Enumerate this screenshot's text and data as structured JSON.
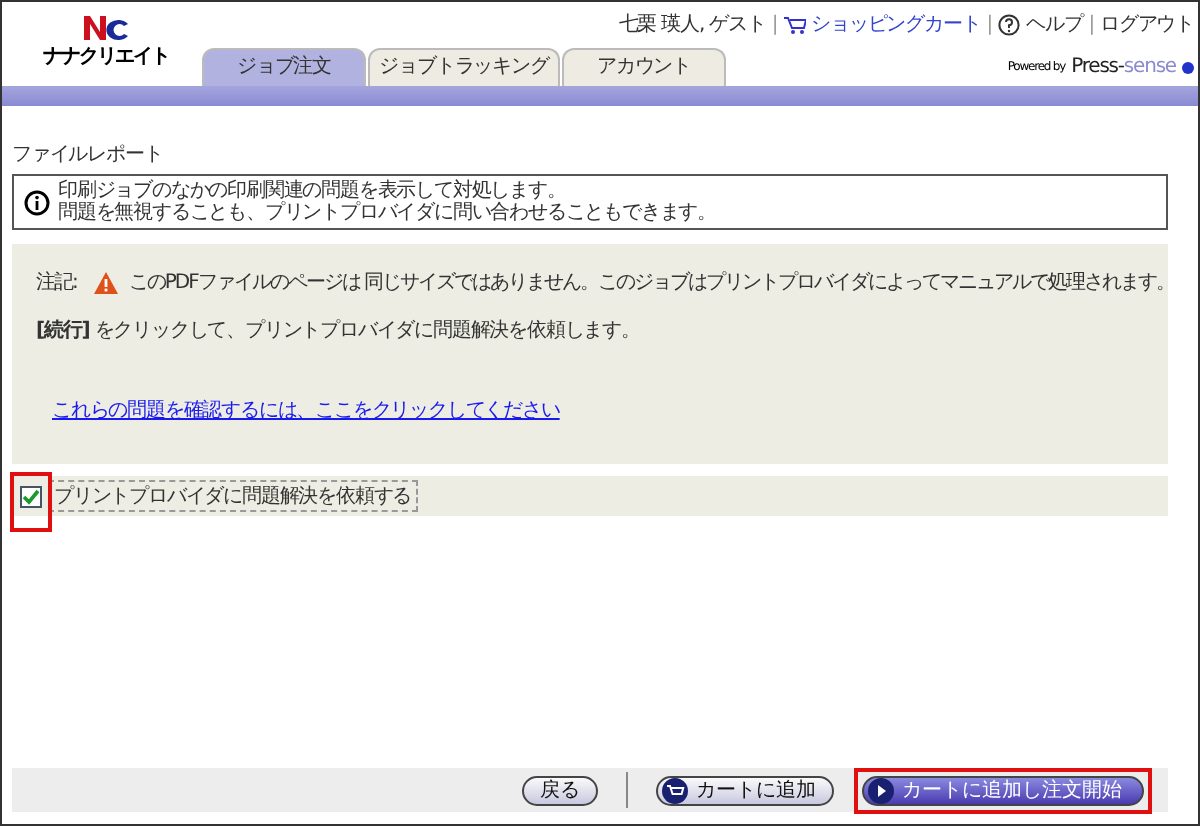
{
  "logo": {
    "text": "ナナクリエイト"
  },
  "tabs": [
    {
      "label": "ジョブ注文",
      "selected": true
    },
    {
      "label": "ジョブトラッキング",
      "selected": false
    },
    {
      "label": "アカウント",
      "selected": false
    }
  ],
  "user_links": [
    {
      "text": "七栗 瑛人, ゲスト",
      "kind": "user"
    },
    {
      "text": "|",
      "kind": "separator"
    },
    {
      "text": "ショッピングカート",
      "kind": "cart"
    },
    {
      "text": "|",
      "kind": "separator"
    },
    {
      "text": "ヘルプ",
      "kind": "help"
    },
    {
      "text": "|",
      "kind": "separator"
    },
    {
      "text": "ログアウト",
      "kind": "logout"
    }
  ],
  "powered_by": {
    "prefix": "Powered by",
    "brand_a": "Press-",
    "brand_b": "sense"
  },
  "page_title": "ファイルレポート",
  "info": {
    "lines": [
      "印刷ジョブのなかの印刷関連の問題を表示して対処します。",
      "問題を無視することも、プリントプロバイダに問い合わせることもできます。"
    ]
  },
  "note": {
    "label": "注記:",
    "text": "このPDFファイルのページは 同じサイズではありません。このジョブはプリントプロバイダによってマニュアルで処理されます。"
  },
  "continue_text": "**[続行]** をクリックして、プリントプロバイダに問題解決を依頼します。",
  "review_link": "これらの問題を確認するには、ここをクリックしてください",
  "request_checkbox": {
    "label": "プリントプロバイダに問題解決を依頼する",
    "checked": true
  },
  "buttons": [
    {
      "label": "戻る",
      "kind": "plain"
    },
    {
      "label": "カートに追加",
      "kind": "cart"
    },
    {
      "label": "カートに追加し注文開始",
      "kind": "primary"
    }
  ]
}
